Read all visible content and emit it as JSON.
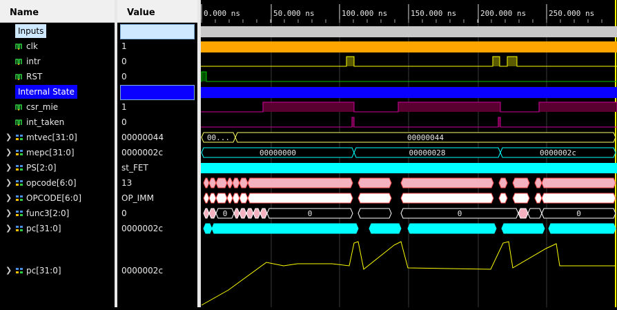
{
  "columns": {
    "name": "Name",
    "value": "Value"
  },
  "signals": [
    {
      "name": "Inputs",
      "value": "",
      "kind": "group",
      "bg": "#cde8ff",
      "vbg": "#cde8ff",
      "fg": "#000000"
    },
    {
      "name": "clk",
      "value": "1",
      "kind": "bit",
      "icon": "bit-icon"
    },
    {
      "name": "intr",
      "value": "0",
      "kind": "bit",
      "icon": "bit-icon"
    },
    {
      "name": "RST",
      "value": "0",
      "kind": "bit",
      "icon": "bit-icon"
    },
    {
      "name": "Internal State",
      "value": "",
      "kind": "group",
      "bg": "#0a00ff",
      "vbg": "#0a00ff",
      "fg": "#ffffff"
    },
    {
      "name": "csr_mie",
      "value": "1",
      "kind": "bit",
      "icon": "bit-icon"
    },
    {
      "name": "int_taken",
      "value": "0",
      "kind": "bit",
      "icon": "bit-icon"
    },
    {
      "name": "mtvec[31:0]",
      "value": "00000044",
      "kind": "bus",
      "icon": "bus-icon"
    },
    {
      "name": "mepc[31:0]",
      "value": "0000002c",
      "kind": "bus",
      "icon": "bus-icon"
    },
    {
      "name": "PS[2:0]",
      "value": "st_FET",
      "kind": "bus",
      "icon": "bus-icon"
    },
    {
      "name": "opcode[6:0]",
      "value": "13",
      "kind": "bus",
      "icon": "bus-icon"
    },
    {
      "name": "OPCODE[6:0]",
      "value": "OP_IMM",
      "kind": "bus",
      "icon": "bus-icon"
    },
    {
      "name": "func3[2:0]",
      "value": "0",
      "kind": "bus",
      "icon": "bus-icon"
    },
    {
      "name": "pc[31:0]",
      "value": "0000002c",
      "kind": "bus",
      "icon": "bus-icon"
    },
    {
      "name": "pc[31:0]",
      "value": "0000002c",
      "kind": "analog",
      "icon": "bus-icon"
    }
  ],
  "ruler": {
    "labels": [
      "0.000 ns",
      "50.000 ns",
      "100.000 ns",
      "150.000 ns",
      "200.000 ns",
      "250.000 ns"
    ]
  },
  "wave_labels": {
    "mtvec": [
      "00...",
      "00000044"
    ],
    "mepc": [
      "00000000",
      "00000028",
      "0000002c"
    ],
    "func3": [
      "0",
      "0",
      "0",
      "0"
    ]
  },
  "colors": {
    "clk": "#ffa500",
    "inputs_band": "#c8c8c8",
    "internal_band": "#0a00ff",
    "pink": "#f4b1c0",
    "cyan": "#00ffff",
    "yellow": "#ffff00",
    "green": "#00c000",
    "magenta": "#d000a0"
  }
}
